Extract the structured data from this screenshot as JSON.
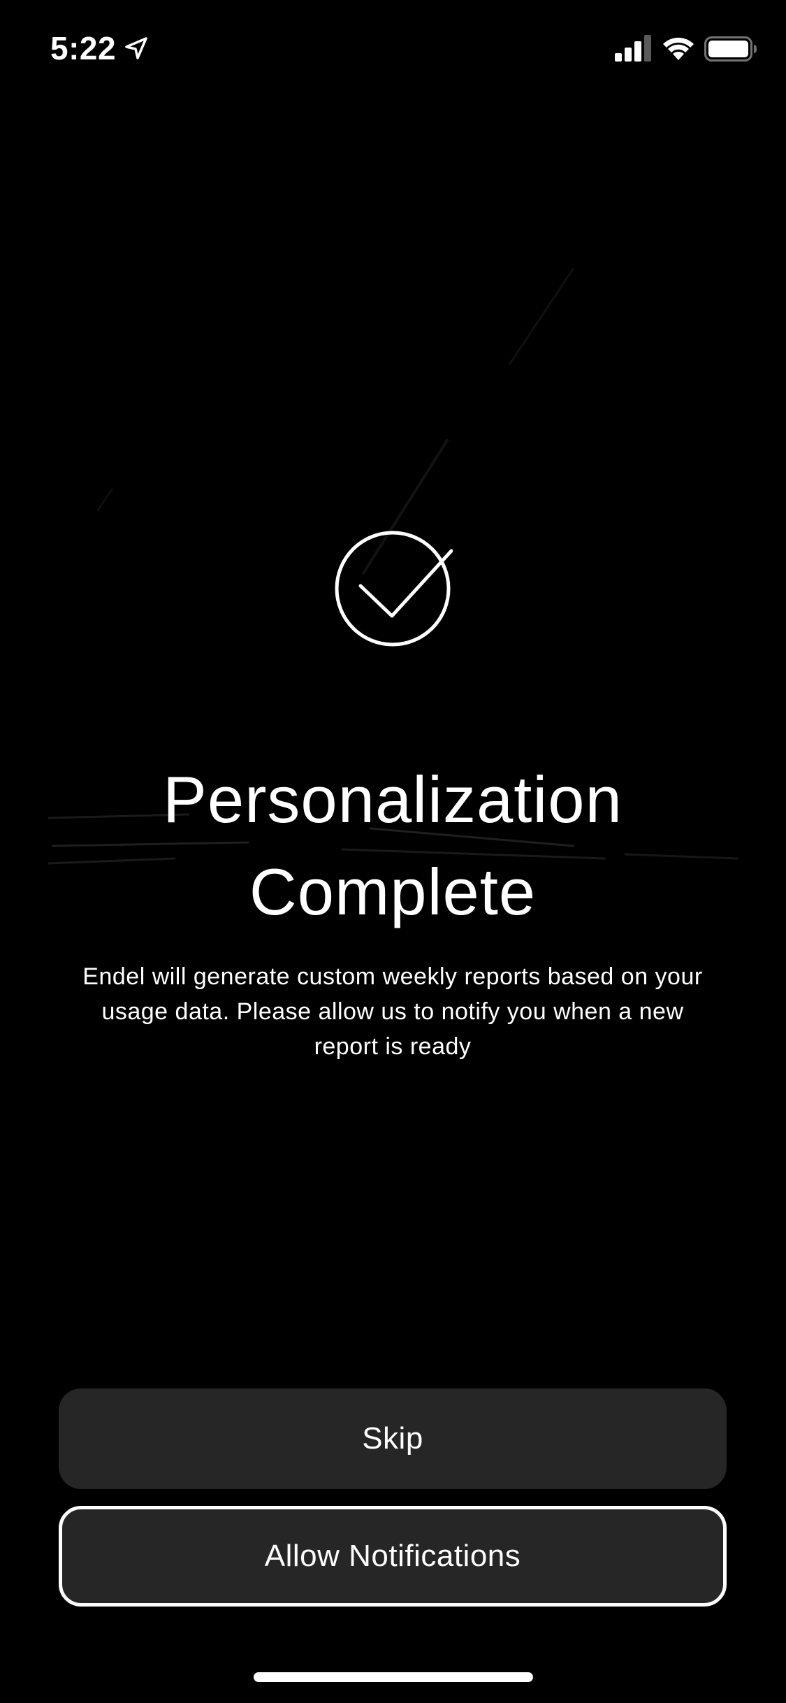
{
  "status_bar": {
    "time": "5:22",
    "icons": [
      "location-arrow-icon",
      "cellular-signal-icon",
      "wifi-icon",
      "battery-icon"
    ]
  },
  "main": {
    "icon": "checkmark-circle-icon",
    "title_line1": "Personalization",
    "title_line2": "Complete",
    "description": "Endel will generate custom weekly reports based on your usage data. Please allow us to notify you when a new report is ready"
  },
  "buttons": {
    "skip_label": "Skip",
    "allow_label": "Allow Notifications"
  },
  "colors": {
    "background": "#000000",
    "text": "#ffffff",
    "button_fill": "#262626",
    "button_border": "#ffffff"
  }
}
